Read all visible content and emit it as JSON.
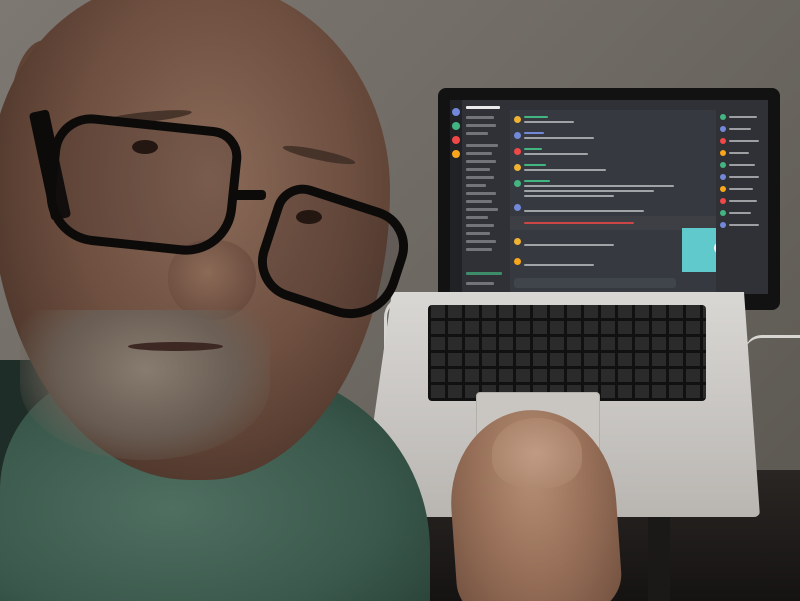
{
  "scene": {
    "kind": "photo",
    "palette": {
      "wall": "#6f6a64",
      "sweater": "#3b5a4d",
      "skin": "#6e4f40",
      "laptop_silver": "#cfccc8",
      "discord_dark": "#36393f",
      "video_tile": "#5fc9cc",
      "glasses": "#0d0b0a"
    },
    "icons": {
      "video_logo": "discord-logo-icon"
    }
  }
}
